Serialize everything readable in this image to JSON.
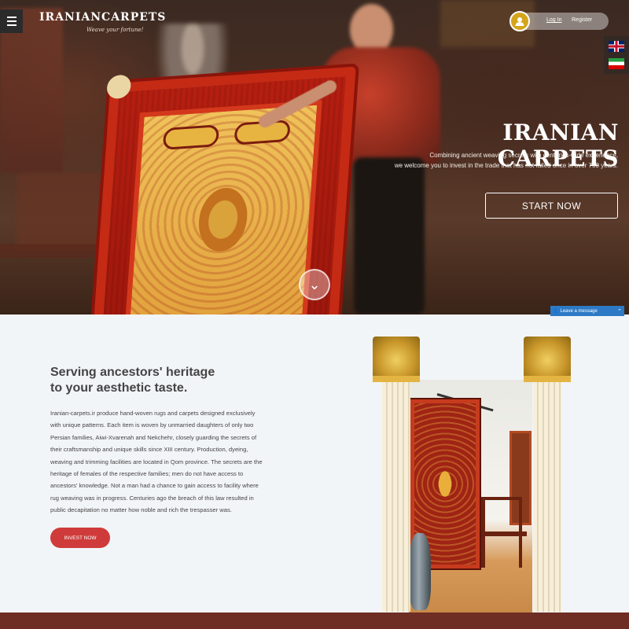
{
  "brand": {
    "name": "IRANIANCARPETS",
    "tagline": "Weave your fortune!"
  },
  "header": {
    "login_label": "Log In",
    "register_label": "Register"
  },
  "hero": {
    "title": "IRANIAN CARPETS",
    "subtitle_lines": [
      "Combining ancient weaving secrets with centuries-wide experience,",
      "we welcome you to invest in the trade that has not failed once in over 700 years."
    ],
    "cta_label": "START NOW"
  },
  "chat": {
    "label": "Leave a message"
  },
  "content": {
    "heading_lines": [
      "Serving ancestors' heritage",
      "to your aesthetic taste."
    ],
    "body_lines": [
      "Iranian-carpets.ir produce hand-woven rugs and carpets designed exclusively",
      "with unique patterns. Each item is woven by unmarried daughters of only two",
      "Persian families, Aiwi-Xvarenah and Nekchehr, closely guarding the secrets of",
      "their craftsmanship and unique skills since XIII century. Production, dyeing,",
      "weaving and trimming facilities are located in Qom province. The secrets are the",
      "heritage of females of the respective families; men do not have access to",
      "ancestors' knowledge. Not a man had a chance to gain access to facility where",
      "rug weaving was in progress. Centuries ago the breach of this law resulted in",
      "public decapitation no matter how noble and rich the trespasser was."
    ],
    "invest_label": "INVEST NOW"
  },
  "icons": {
    "menu": "hamburger-icon",
    "user": "user-icon",
    "scroll": "chevron-down-icon",
    "chat_person": "person-icon",
    "chat_toggle": "chevron-up-icon",
    "flags": [
      "uk-flag-icon",
      "iran-flag-icon"
    ]
  },
  "colors": {
    "accent": "#cf3b3b",
    "gold": "#d4a51c",
    "chat_blue": "#2d79c5",
    "footer": "#6e2e24"
  }
}
